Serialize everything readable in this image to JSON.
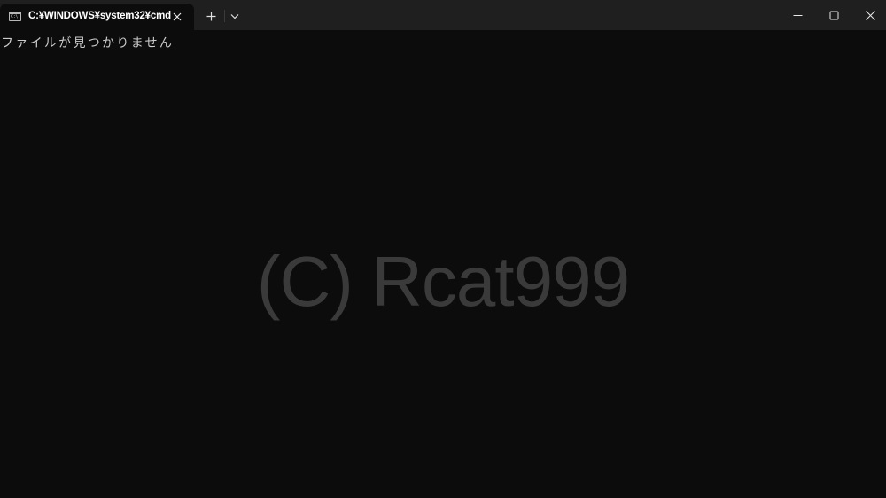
{
  "tab": {
    "icon_text": "C:\\.",
    "title": "C:¥WINDOWS¥system32¥cmd"
  },
  "titlebar": {
    "icons": {
      "tab_icon": "cmd-icon",
      "close": "close-icon",
      "new_tab": "plus-icon",
      "dropdown": "chevron-down-icon",
      "minimize": "minimize-icon",
      "maximize": "maximize-icon",
      "window_close": "close-icon"
    }
  },
  "console": {
    "lines": [
      "ファイルが見つかりません"
    ]
  },
  "watermark": {
    "text": "(C) Rcat999"
  },
  "colors": {
    "background": "#0c0c0c",
    "titlebar": "#1f1f1f",
    "text": "#cccccc",
    "watermark": "#3a3a3a"
  }
}
